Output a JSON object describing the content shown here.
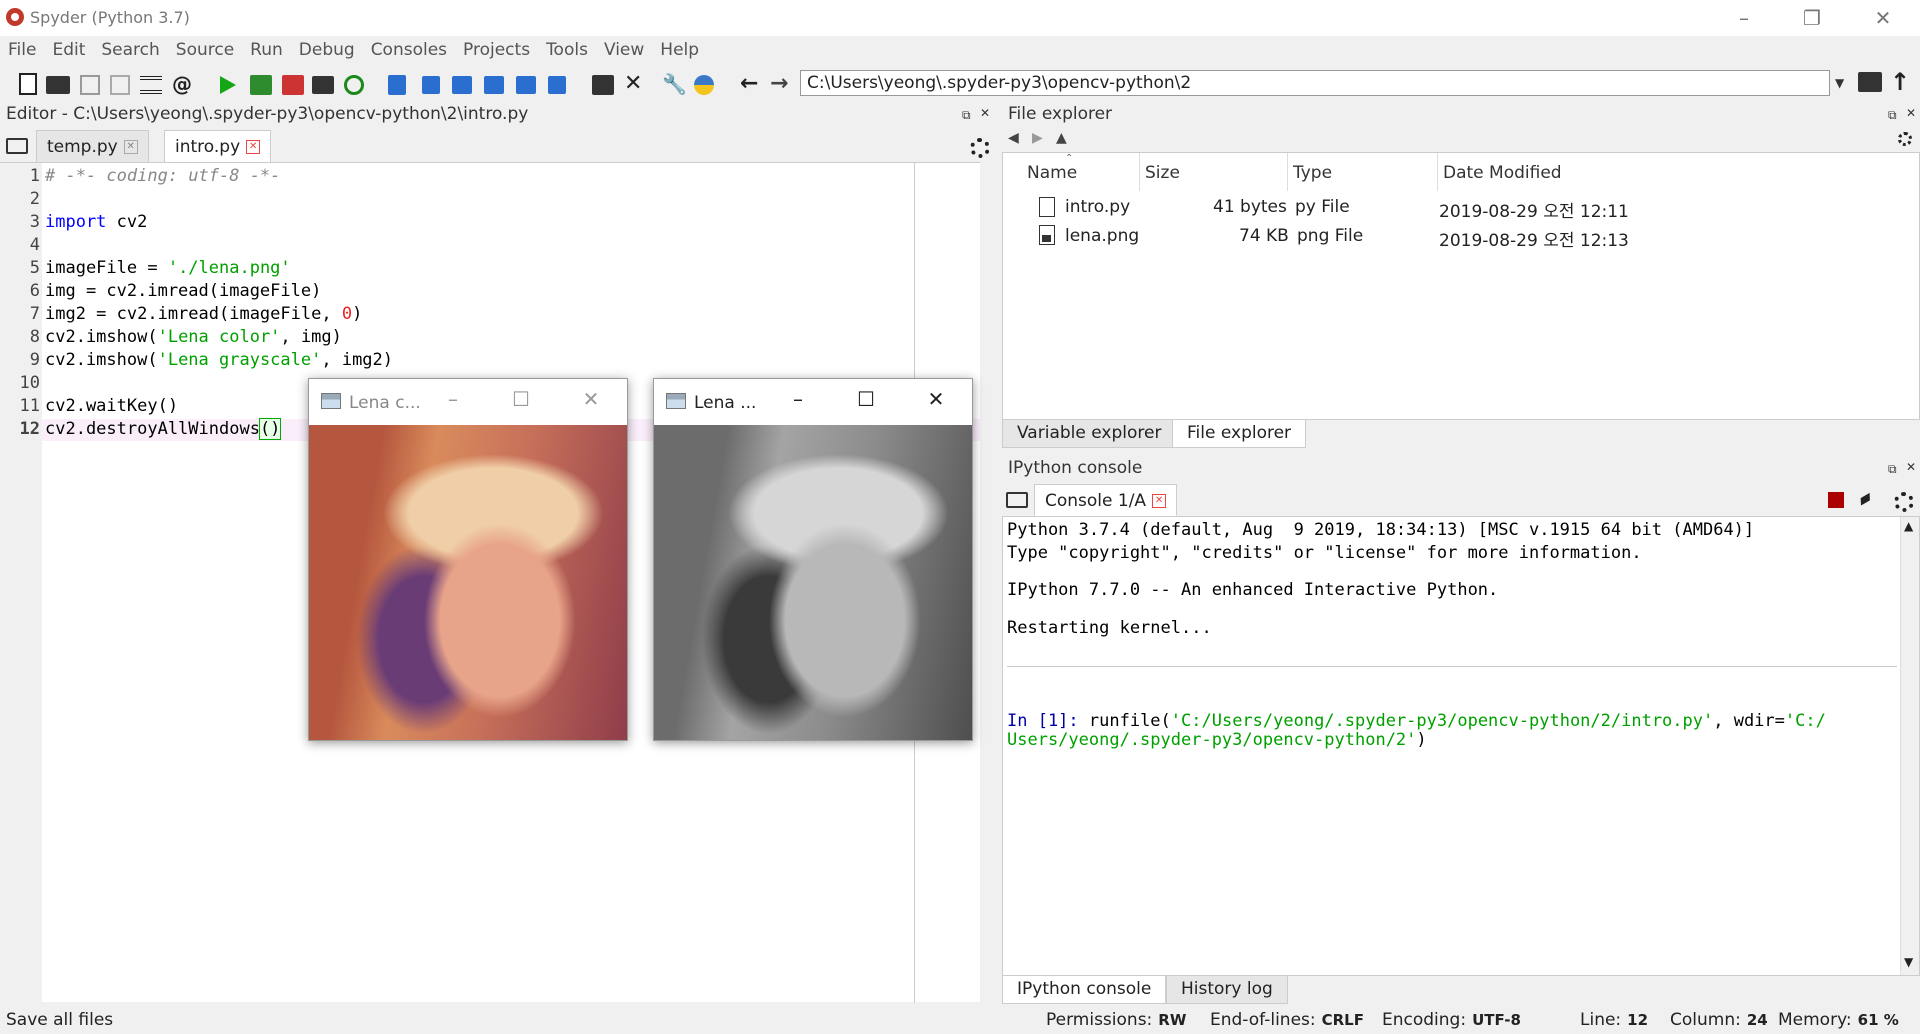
{
  "window": {
    "title": "Spyder (Python 3.7)"
  },
  "menu": [
    "File",
    "Edit",
    "Search",
    "Source",
    "Run",
    "Debug",
    "Consoles",
    "Projects",
    "Tools",
    "View",
    "Help"
  ],
  "toolbar": {
    "path": "C:\\Users\\yeong\\.spyder-py3\\opencv-python\\2"
  },
  "editor": {
    "header": "Editor - C:\\Users\\yeong\\.spyder-py3\\opencv-python\\2\\intro.py",
    "tabs": [
      "temp.py",
      "intro.py"
    ],
    "line_numbers": [
      "1",
      "2",
      "3",
      "4",
      "5",
      "6",
      "7",
      "8",
      "9",
      "10",
      "11",
      "12"
    ]
  },
  "cv_windows": [
    {
      "title": "Lena c..."
    },
    {
      "title": "Lena ..."
    }
  ],
  "file_explorer": {
    "header": "File explorer",
    "columns": [
      "Name",
      "Size",
      "Type",
      "Date Modified"
    ],
    "rows": [
      {
        "name": "intro.py",
        "size": "41 bytes",
        "type": "py File",
        "modified": "2019-08-29 오전 12:11"
      },
      {
        "name": "lena.png",
        "size": "74 KB",
        "type": "png File",
        "modified": "2019-08-29 오전 12:13"
      }
    ],
    "tabs": [
      "Variable explorer",
      "File explorer"
    ]
  },
  "console": {
    "header": "IPython console",
    "tab": "Console 1/A",
    "lines": [
      "Python 3.7.4 (default, Aug  9 2019, 18:34:13) [MSC v.1915 64 bit (AMD64)]",
      "Type \"copyright\", \"credits\" or \"license\" for more information.",
      "IPython 7.7.0 -- An enhanced Interactive Python.",
      "Restarting kernel..."
    ],
    "prompt": "In [1]:",
    "command": " runfile(",
    "arg1": "'C:/Users/yeong/.spyder-py3/opencv-python/2/intro.py'",
    "wdir": ", wdir=",
    "arg2a": "'C:/",
    "arg2b": "Users/yeong/.spyder-py3/opencv-python/2'",
    "close": ")",
    "tabs": [
      "IPython console",
      "History log"
    ]
  },
  "status": {
    "message": "Save all files",
    "permissions_label": "Permissions:",
    "permissions": "RW",
    "eol_label": "End-of-lines:",
    "eol": "CRLF",
    "encoding_label": "Encoding:",
    "encoding": "UTF-8",
    "line_label": "Line:",
    "line": "12",
    "column_label": "Column:",
    "column": "24",
    "memory_label": "Memory:",
    "memory": "61 %"
  }
}
